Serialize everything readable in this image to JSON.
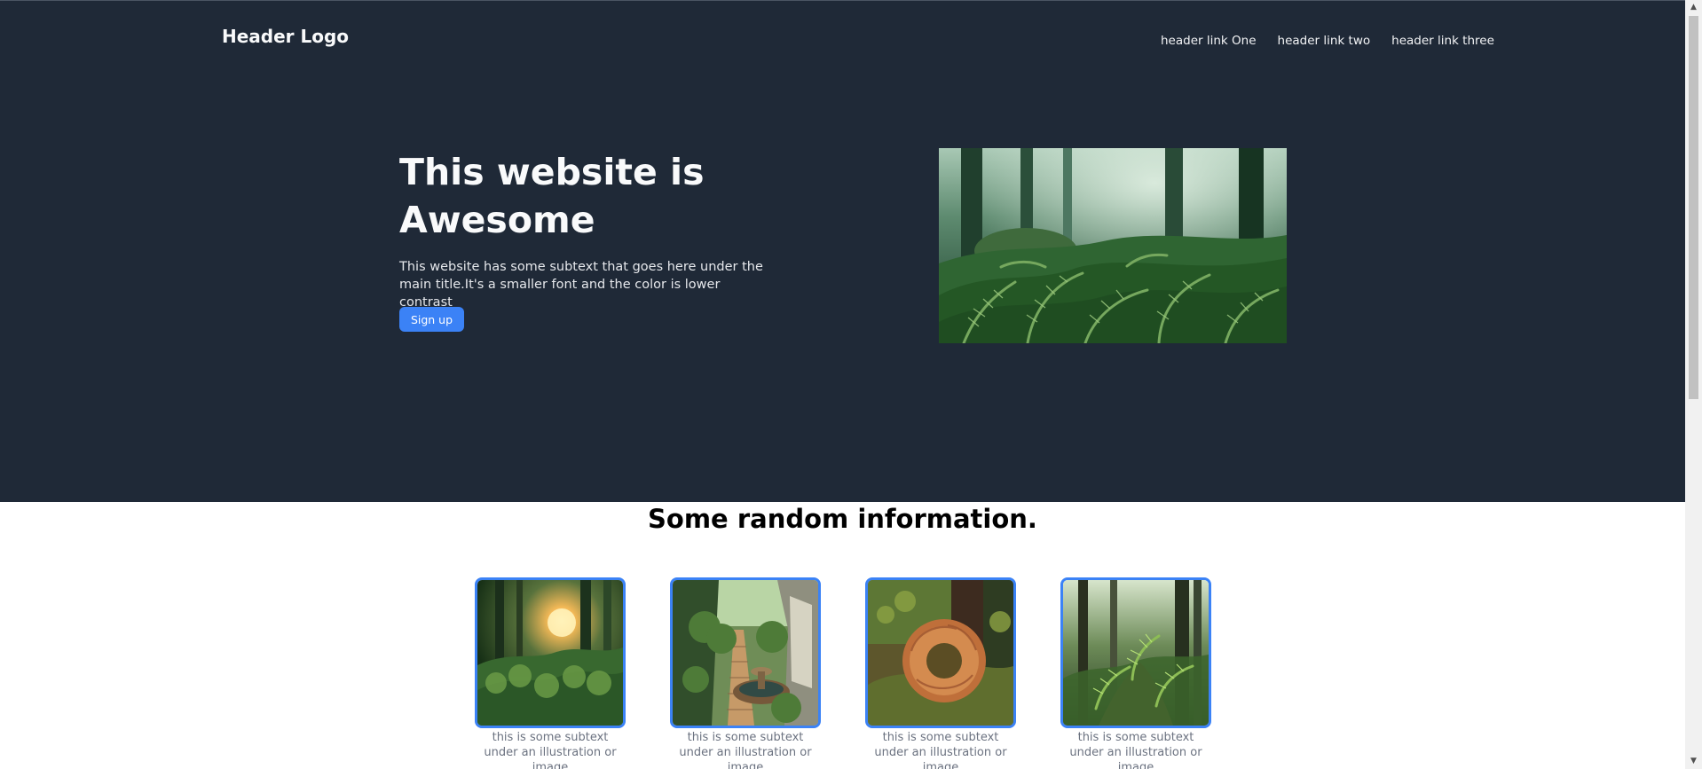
{
  "header": {
    "logo": "Header Logo",
    "links": [
      "header link One",
      "header link two",
      "header link three"
    ]
  },
  "hero": {
    "title": "This website is Awesome",
    "subtext": "This website has some subtext that goes here under the main title.It's a smaller font and the color is lower contrast",
    "button_label": "Sign up"
  },
  "info": {
    "title": "Some random information.",
    "cards": [
      {
        "caption": "this is some subtext under an illustration or image"
      },
      {
        "caption": "this is some subtext under an illustration or image"
      },
      {
        "caption": "this is some subtext under an illustration or image"
      },
      {
        "caption": "this is some subtext under an illustration or image"
      }
    ]
  },
  "colors": {
    "hero_background": "#1f2937",
    "accent": "#3b82f6",
    "caption": "#6b7280"
  },
  "icons": {
    "scroll_up": "triangle-up",
    "scroll_down": "triangle-down"
  }
}
